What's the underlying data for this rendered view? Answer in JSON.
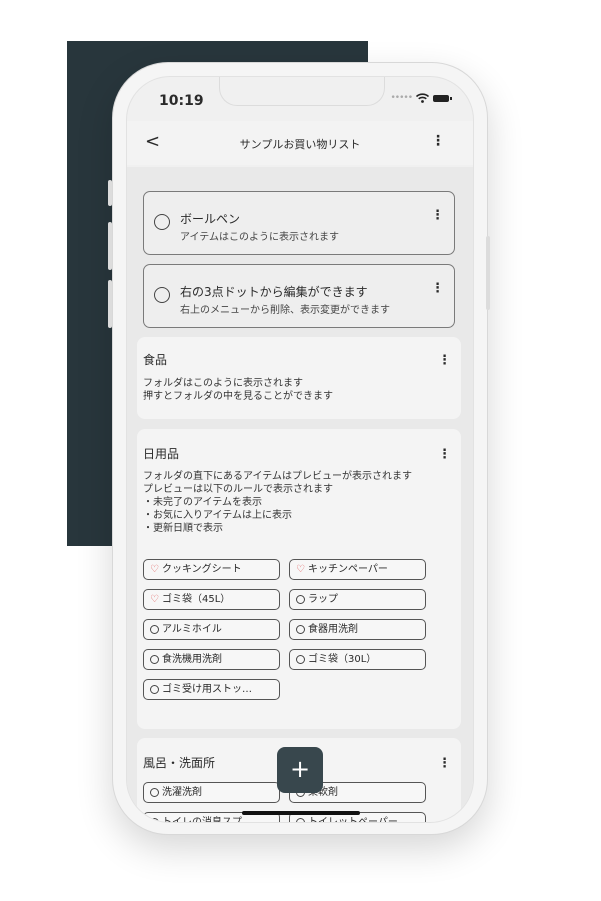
{
  "status": {
    "time": "10:19"
  },
  "nav": {
    "back": "<",
    "title": "サンプルお買い物リスト",
    "more": "⋮"
  },
  "items": [
    {
      "title": "ボールペン",
      "subtitle": "アイテムはこのように表示されます"
    },
    {
      "title": "右の3点ドットから編集ができます",
      "subtitle": "右上のメニューから削除、表示変更ができます"
    }
  ],
  "folders": {
    "food": {
      "title": "食品",
      "desc": "フォルダはこのように表示されます\n押すとフォルダの中を見ることができます"
    },
    "daily": {
      "title": "日用品",
      "desc": "フォルダの直下にあるアイテムはプレビューが表示されます\nプレビューは以下のルールで表示されます\n・未完了のアイテムを表示\n・お気に入りアイテムは上に表示\n・更新日順で表示",
      "chips": [
        {
          "label": "クッキングシート",
          "favorite": true
        },
        {
          "label": "キッチンペーパー",
          "favorite": true
        },
        {
          "label": "ゴミ袋（45L）",
          "favorite": true
        },
        {
          "label": "ラップ",
          "favorite": false
        },
        {
          "label": "アルミホイル",
          "favorite": false
        },
        {
          "label": "食器用洗剤",
          "favorite": false
        },
        {
          "label": "食洗機用洗剤",
          "favorite": false
        },
        {
          "label": "ゴミ袋（30L）",
          "favorite": false
        },
        {
          "label": "ゴミ受け用ストッ…",
          "favorite": false
        }
      ]
    },
    "bath": {
      "title": "風呂・洗面所",
      "chips": [
        {
          "label": "洗濯洗剤",
          "favorite": false
        },
        {
          "label": "柔軟剤",
          "favorite": false
        },
        {
          "label": "トイレの消臭スプ…",
          "favorite": false
        },
        {
          "label": "トイレットペーパー",
          "favorite": false
        }
      ]
    }
  },
  "fab": "+",
  "colors": {
    "background_block": "#28363c",
    "fab": "#38474d",
    "favorite": "#e05a5a"
  }
}
